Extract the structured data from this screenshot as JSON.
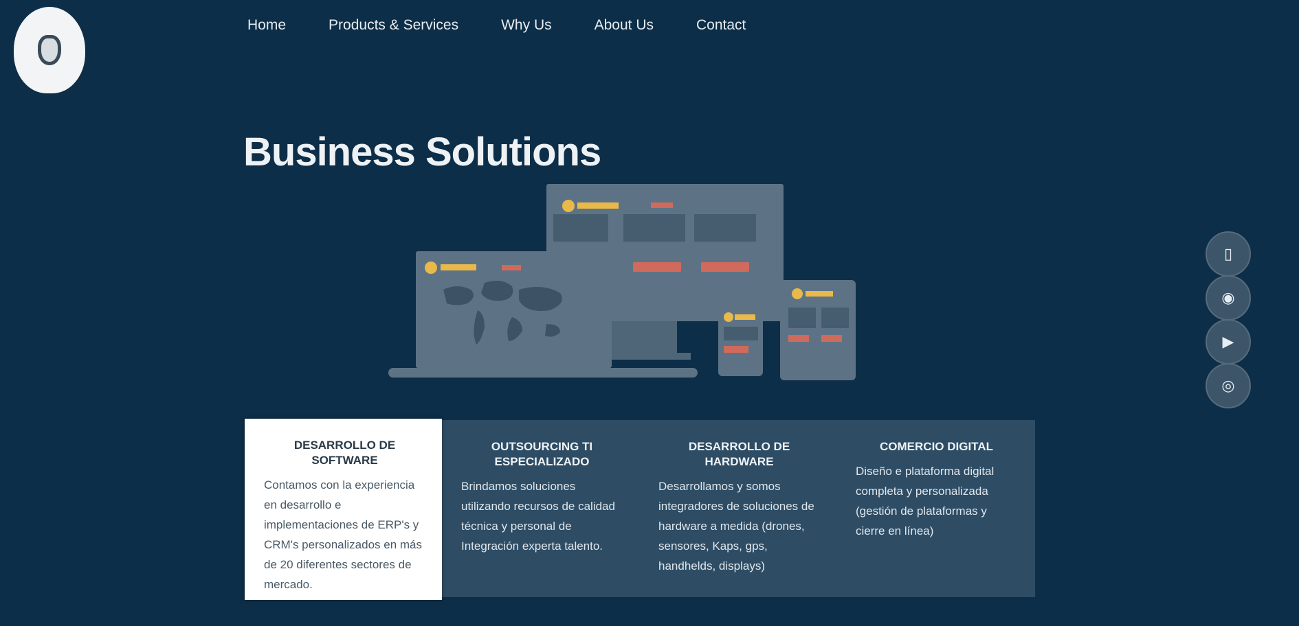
{
  "nav": {
    "items": [
      {
        "label": "Home"
      },
      {
        "label": "Products & Services"
      },
      {
        "label": "Why Us"
      },
      {
        "label": "About Us"
      },
      {
        "label": "Contact"
      }
    ]
  },
  "hero": {
    "title": "Business Solutions"
  },
  "cards": [
    {
      "title": "DESARROLLO DE SOFTWARE",
      "text": "Contamos con la experiencia en desarrollo e implementaciones de ERP's y CRM's personalizados en más de 20 diferentes sectores de mercado."
    },
    {
      "title": "OUTSOURCING TI ESPECIALIZADO",
      "text": "Brindamos soluciones utilizando recursos de calidad técnica y personal de Integración experta talento."
    },
    {
      "title": "DESARROLLO DE HARDWARE",
      "text": "Desarrollamos y somos integradores de soluciones de hardware a medida (drones, sensores, Kaps, gps, handhelds, displays)"
    },
    {
      "title": "COMERCIO DIGITAL",
      "text": "Diseño e plataforma digital completa y personalizada (gestión de plataformas y cierre en línea)"
    }
  ],
  "social": [
    {
      "icon": "mobile-icon"
    },
    {
      "icon": "camera-icon"
    },
    {
      "icon": "video-icon"
    },
    {
      "icon": "globe-icon"
    }
  ],
  "colors": {
    "background": "#0d2e48",
    "card_band": "#2e4d65",
    "device_body": "#5d7385",
    "accent_yellow": "#e9b94a",
    "accent_red": "#d06a5c"
  }
}
